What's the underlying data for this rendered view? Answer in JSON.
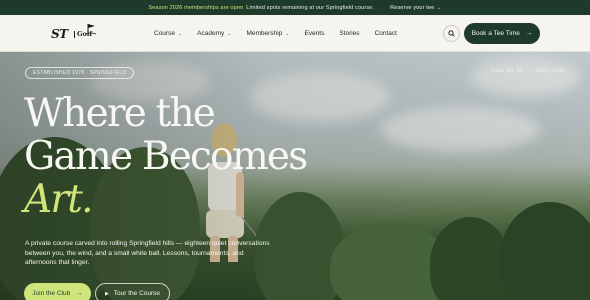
{
  "announcement": {
    "highlight": "Season 2026 memberships are open",
    "text": "Limited spots remaining at our Springfield course.",
    "link": "Reserve your tee →"
  },
  "nav": {
    "logo_text": "ST",
    "logo_sub": "Golf",
    "items": [
      {
        "label": "Course",
        "has_dropdown": true
      },
      {
        "label": "Academy",
        "has_dropdown": true
      },
      {
        "label": "Membership",
        "has_dropdown": true
      },
      {
        "label": "Events",
        "has_dropdown": false
      },
      {
        "label": "Stories",
        "has_dropdown": false
      },
      {
        "label": "Contact",
        "has_dropdown": false
      }
    ],
    "cta": "Book a Tee Time",
    "cta_arrow": "→"
  },
  "hero": {
    "badge": "ESTABLISHED 1978 · SPRINGFIELD",
    "issue": "Issue No. 04",
    "season": "Spring 2026",
    "headline_line1": "Where the",
    "headline_line2": "Game Becomes",
    "headline_accent": "Art.",
    "description": "A private course carved into rolling Springfield hills — eighteen quiet conversations between you, the wind, and a small white ball. Lessons, tournaments, and afternoons that linger.",
    "primary_button": "Join the Club",
    "primary_arrow": "→",
    "secondary_button": "Tour the Course",
    "secondary_icon": "▶"
  },
  "colors": {
    "forest": "#1d3a2a",
    "lime": "#cfe57a",
    "cream": "#f6f4ee"
  }
}
